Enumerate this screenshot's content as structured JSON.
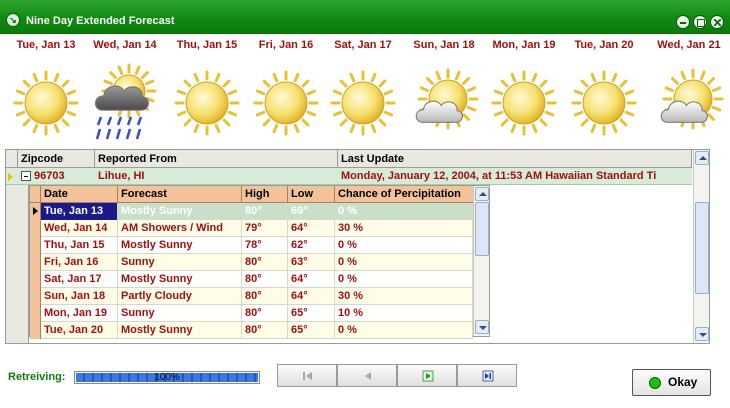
{
  "window": {
    "title": "Nine Day Extended Forecast"
  },
  "days": [
    {
      "label": "Tue, Jan 13",
      "icon": "sunny-icon"
    },
    {
      "label": "Wed, Jan 14",
      "icon": "showers-icon"
    },
    {
      "label": "Thu, Jan 15",
      "icon": "sunny-icon"
    },
    {
      "label": "Fri, Jan 16",
      "icon": "sunny-icon"
    },
    {
      "label": "Sat, Jan 17",
      "icon": "sunny-icon"
    },
    {
      "label": "Sun, Jan 18",
      "icon": "partly-cloudy-icon"
    },
    {
      "label": "Mon, Jan 19",
      "icon": "sunny-icon"
    },
    {
      "label": "Tue, Jan 20",
      "icon": "sunny-icon"
    },
    {
      "label": "Wed, Jan 21",
      "icon": "partly-cloudy-icon"
    }
  ],
  "grid": {
    "headers": {
      "zipcode": "Zipcode",
      "reported_from": "Reported From",
      "last_update": "Last Update"
    },
    "record": {
      "zipcode": "96703",
      "reported_from": "Lihue, HI",
      "last_update": "Monday, January 12, 2004, at 11:53 AM Hawaiian Standard Ti"
    }
  },
  "forecast": {
    "headers": {
      "date": "Date",
      "forecast": "Forecast",
      "high": "High",
      "low": "Low",
      "chance": "Chance of Percipitation"
    },
    "rows": [
      {
        "date": "Tue, Jan 13",
        "forecast": "Mostly Sunny",
        "high": "80°",
        "low": "69°",
        "chance": "0 %"
      },
      {
        "date": "Wed, Jan 14",
        "forecast": "AM Showers / Wind",
        "high": "79°",
        "low": "64°",
        "chance": "30 %"
      },
      {
        "date": "Thu, Jan 15",
        "forecast": "Mostly Sunny",
        "high": "78°",
        "low": "62°",
        "chance": "0 %"
      },
      {
        "date": "Fri, Jan 16",
        "forecast": "Sunny",
        "high": "80°",
        "low": "63°",
        "chance": "0 %"
      },
      {
        "date": "Sat, Jan 17",
        "forecast": "Mostly Sunny",
        "high": "80°",
        "low": "64°",
        "chance": "0 %"
      },
      {
        "date": "Sun, Jan 18",
        "forecast": "Partly Cloudy",
        "high": "80°",
        "low": "64°",
        "chance": "30 %"
      },
      {
        "date": "Mon, Jan 19",
        "forecast": "Sunny",
        "high": "80°",
        "low": "65°",
        "chance": "10 %"
      },
      {
        "date": "Tue, Jan 20",
        "forecast": "Mostly Sunny",
        "high": "80°",
        "low": "65°",
        "chance": "0 %"
      }
    ]
  },
  "status": {
    "label": "Retreiving:",
    "progress_text": "100%",
    "progress": 1.0
  },
  "nav": {
    "first": "first-record-icon",
    "prev": "previous-record-icon",
    "next": "next-record-icon",
    "last": "last-record-icon"
  },
  "okay": {
    "label": "Okay"
  },
  "colors": {
    "title_bar": "#118a11",
    "day_label": "#a01010",
    "cell_text": "#a01010",
    "sub_header": "#f2c39a",
    "selected_row": "#c9dfc9",
    "ok_dot": "#18c018"
  }
}
